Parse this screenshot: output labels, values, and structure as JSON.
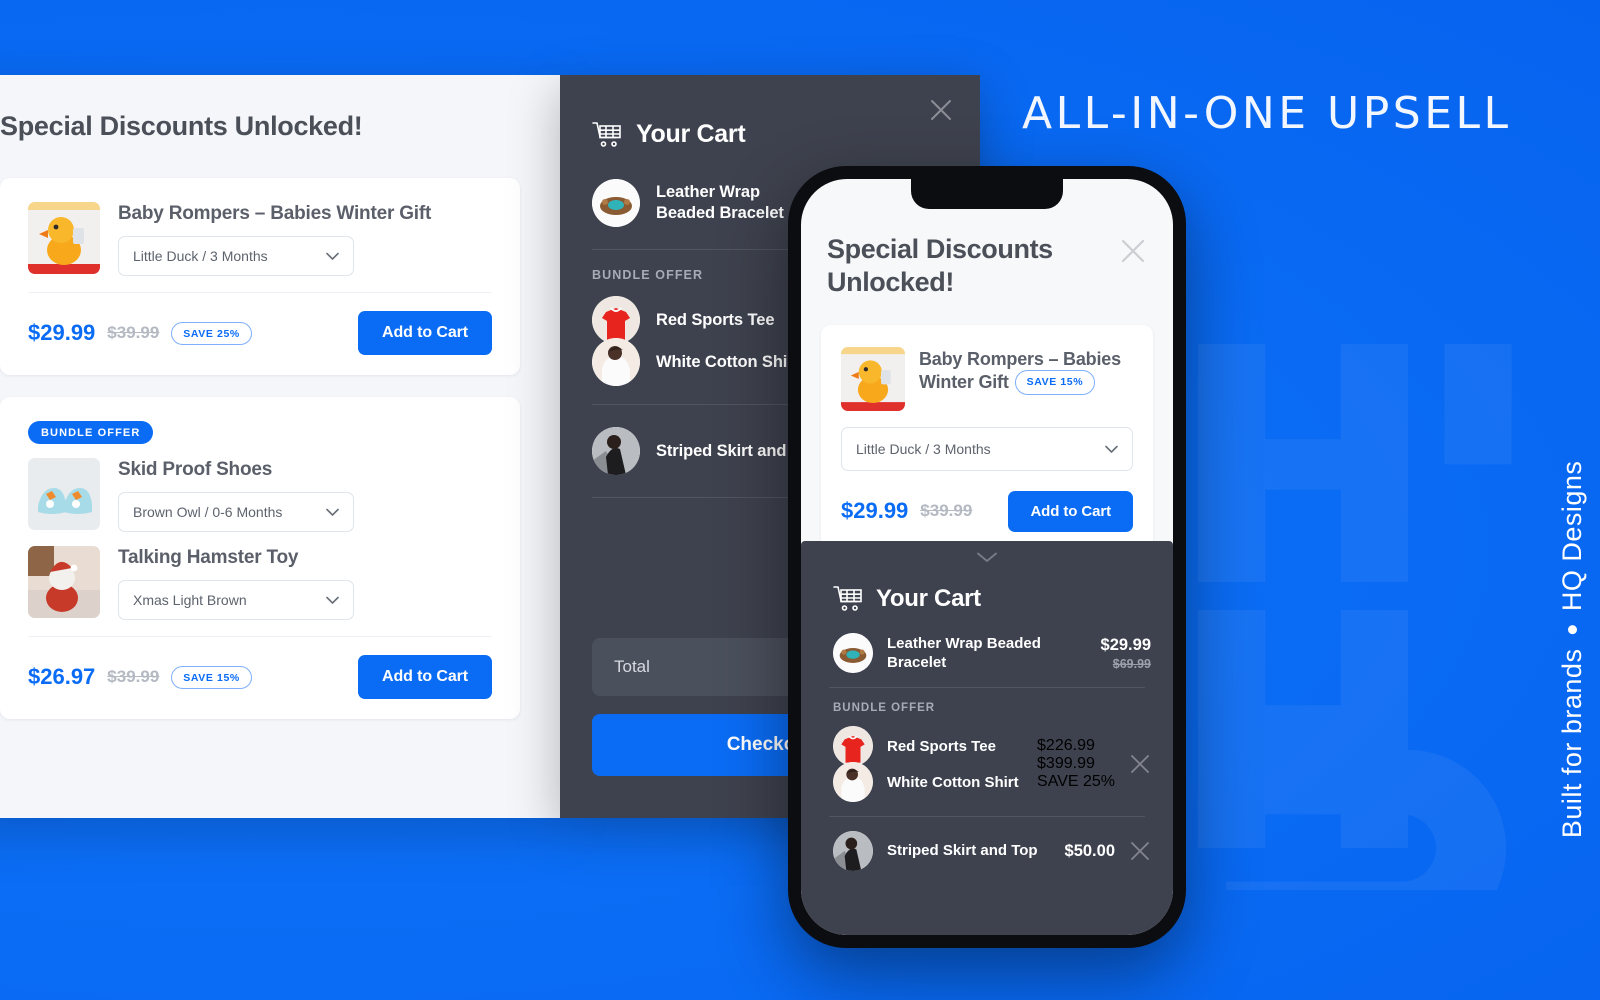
{
  "background": {
    "accent": "#0a6cf5",
    "dark_panel": "#3e424e",
    "watermark_text": "HQ"
  },
  "promo": {
    "headline": "ALL-IN-ONE UPSELL",
    "side_text_left": "Built for brands",
    "side_text_right": "HQ Designs"
  },
  "desktop_offer_panel": {
    "title": "Special Discounts Unlocked!",
    "cards": [
      {
        "bundle_label": null,
        "products": [
          {
            "name": "Baby Rompers – Babies Winter Gift",
            "variant": "Little Duck / 3 Months",
            "thumb": "baby-romper-duck-photo"
          }
        ],
        "price_now": "$29.99",
        "price_old": "$39.99",
        "save_badge": "SAVE 25%",
        "cta": "Add to Cart"
      },
      {
        "bundle_label": "BUNDLE OFFER",
        "products": [
          {
            "name": "Skid Proof Shoes",
            "variant": "Brown Owl / 0-6 Months",
            "thumb": "skid-proof-shoes-photo"
          },
          {
            "name": "Talking Hamster Toy",
            "variant": "Xmas Light Brown",
            "thumb": "talking-hamster-toy-photo"
          }
        ],
        "price_now": "$26.97",
        "price_old": "$39.99",
        "save_badge": "SAVE 15%",
        "cta": "Add to Cart"
      }
    ]
  },
  "desktop_cart_panel": {
    "title": "Your Cart",
    "cart_icon": "shopping-cart-icon",
    "close_icon": "close-icon",
    "items": [
      {
        "name": "Leather Wrap Beaded Bracelet",
        "avatar": "beaded-bracelet-photo"
      }
    ],
    "bundle_label": "BUNDLE OFFER",
    "bundle_items": [
      {
        "name": "Red Sports Tee",
        "avatar": "red-tee-photo"
      },
      {
        "name": "White Cotton Shirt",
        "avatar": "white-shirt-photo"
      }
    ],
    "more_items": [
      {
        "name": "Striped Skirt and Top",
        "avatar": "striped-skirt-photo"
      }
    ],
    "total_label": "Total",
    "checkout_label": "Checkout"
  },
  "phone": {
    "title": "Special Discounts Unlocked!",
    "close_icon": "close-icon",
    "offer": {
      "product_name": "Baby Rompers – Babies Winter Gift",
      "save_badge": "SAVE 15%",
      "variant": "Little Duck / 3 Months",
      "price_now": "$29.99",
      "price_old": "$39.99",
      "cta": "Add to Cart"
    },
    "cart": {
      "handle_icon": "chevron-down-icon",
      "cart_icon": "shopping-cart-icon",
      "title": "Your Cart",
      "items": [
        {
          "name": "Leather Wrap Beaded Bracelet",
          "avatar": "beaded-bracelet-photo",
          "price_now": "$29.99",
          "price_old": "$69.99"
        }
      ],
      "bundle_label": "BUNDLE OFFER",
      "bundle": {
        "items": [
          {
            "name": "Red Sports Tee",
            "avatar": "red-tee-photo"
          },
          {
            "name": "White Cotton Shirt",
            "avatar": "white-shirt-photo"
          }
        ],
        "price_now": "$226.99",
        "price_old": "$399.99",
        "save_badge": "SAVE 25%",
        "remove_icon": "close-icon"
      },
      "last_item": {
        "name": "Striped Skirt and Top",
        "avatar": "striped-skirt-photo",
        "price_now": "$50.00",
        "remove_icon": "close-icon"
      }
    }
  }
}
